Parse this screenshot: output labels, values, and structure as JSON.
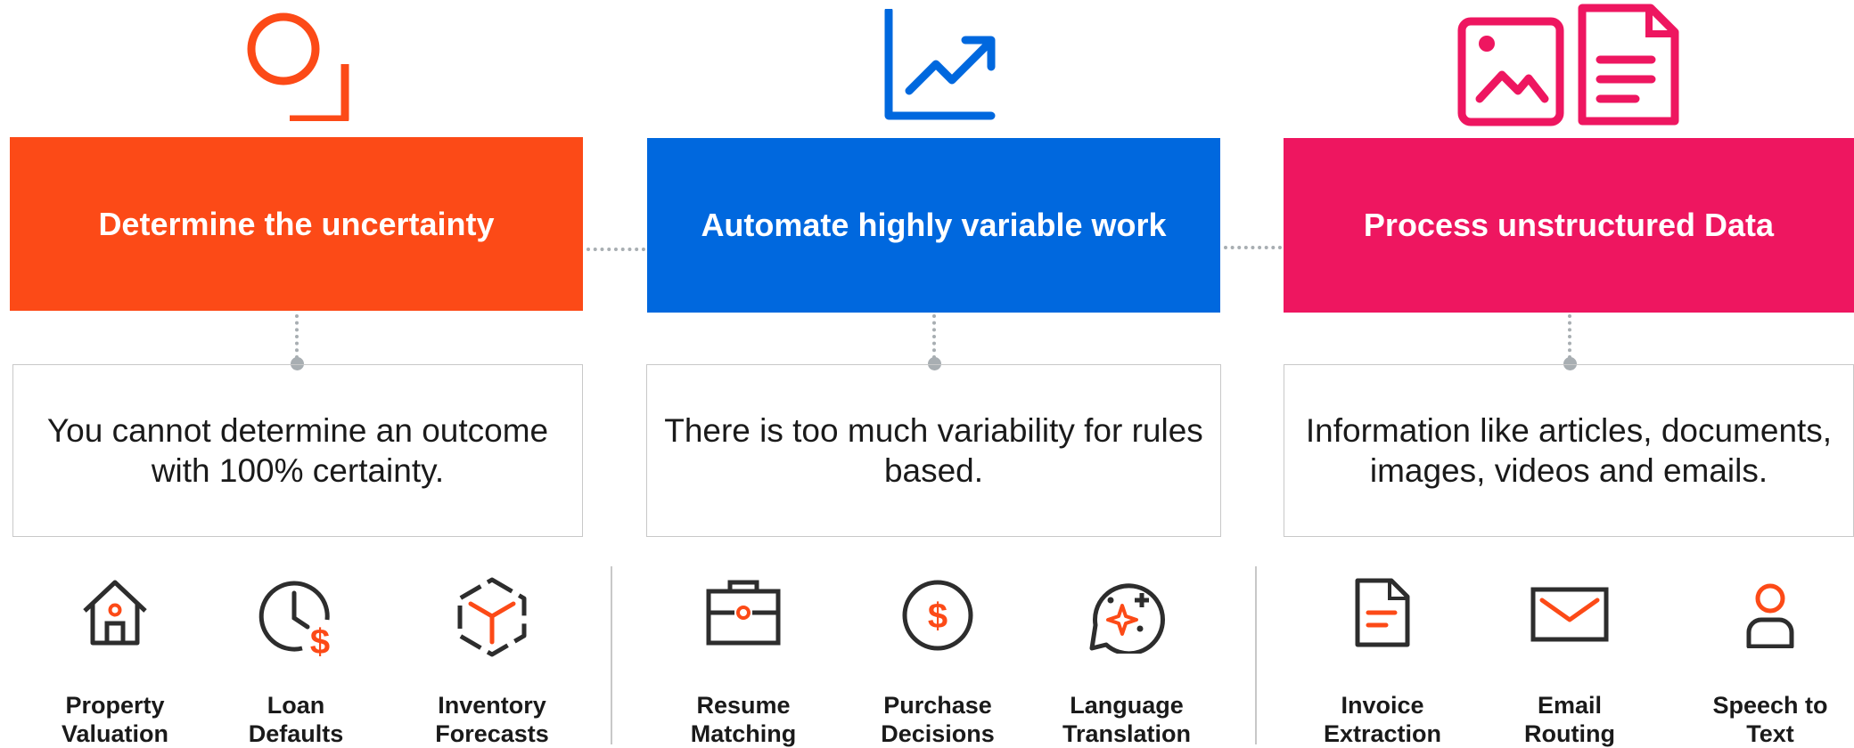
{
  "colors": {
    "orange": "#fc4a17",
    "blue": "#0068de",
    "pink": "#ee1660",
    "dark": "#2d2d2d",
    "connector": "#a8aeb2"
  },
  "columns": [
    {
      "icon": "magnifier-icon",
      "title": "Determine the uncertainty",
      "description": "You cannot determine an outcome with 100% certainty.",
      "use_cases": [
        {
          "icon": "house-icon",
          "label": "Property\nValuation"
        },
        {
          "icon": "clock-dollar-icon",
          "label": "Loan\nDefaults"
        },
        {
          "icon": "cube-icon",
          "label": "Inventory\nForecasts"
        }
      ]
    },
    {
      "icon": "trend-chart-icon",
      "title": "Automate highly variable work",
      "description": "There is too much variability for rules based.",
      "use_cases": [
        {
          "icon": "briefcase-icon",
          "label": "Resume\nMatching"
        },
        {
          "icon": "dollar-coin-icon",
          "label": "Purchase\nDecisions"
        },
        {
          "icon": "chat-sparkle-icon",
          "label": "Language\nTranslation"
        }
      ]
    },
    {
      "icon": "image-document-icon",
      "title": "Process unstructured Data",
      "description": "Information like articles, documents, images, videos and emails.",
      "use_cases": [
        {
          "icon": "document-icon",
          "label": "Invoice\nExtraction"
        },
        {
          "icon": "envelope-icon",
          "label": "Email\nRouting"
        },
        {
          "icon": "person-icon",
          "label": "Speech to\nText"
        }
      ]
    }
  ]
}
